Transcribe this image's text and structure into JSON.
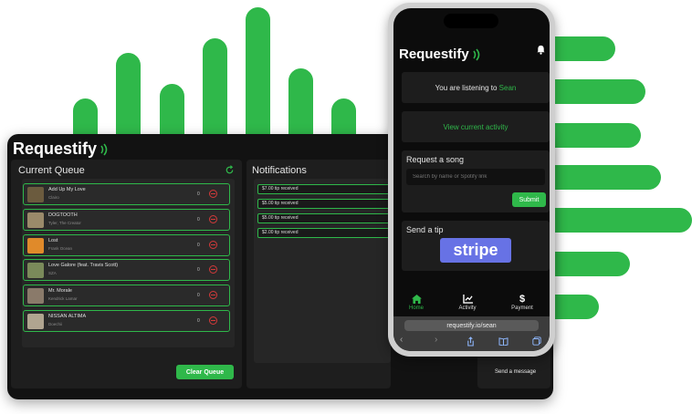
{
  "colors": {
    "accent": "#2fb84a",
    "danger": "#d43a3a",
    "background": "#121212"
  },
  "dashboard": {
    "brand": "Requestify",
    "queue_title": "Current Queue",
    "notifications_title": "Notifications",
    "clear_label": "Clear Queue",
    "send_message_label": "Send a message",
    "songs": [
      {
        "title": "Add Up My Love",
        "artist": "Clairo",
        "count": "0",
        "art": "#6b5b3e"
      },
      {
        "title": "DOGTOOTH",
        "artist": "Tyler, The Creator",
        "count": "0",
        "art": "#9a8a6a"
      },
      {
        "title": "Lost",
        "artist": "Frank Ocean",
        "count": "0",
        "art": "#e08a2a"
      },
      {
        "title": "Love Galore (feat. Travis Scott)",
        "artist": "SZA",
        "count": "0",
        "art": "#7a8a5a"
      },
      {
        "title": "Mr. Morale",
        "artist": "Kendrick Lamar",
        "count": "0",
        "art": "#8a7a6a"
      },
      {
        "title": "NISSAN ALTIMA",
        "artist": "Doechii",
        "count": "0",
        "art": "#b0a590"
      }
    ],
    "notifications": [
      "$7.00 tip received",
      "$5.00 tip received",
      "$5.00 tip received",
      "$2.00 tip received"
    ]
  },
  "phone": {
    "brand": "Requestify",
    "listening_prefix": "You are listening to",
    "dj_name": "Sean",
    "view_activity": "View current activity",
    "request_title": "Request a song",
    "search_placeholder": "Search by name or Spotify link",
    "submit_label": "Submit",
    "tip_title": "Send a tip",
    "stripe_label": "stripe",
    "nav": [
      {
        "label": "Home",
        "icon": "home-icon"
      },
      {
        "label": "Activity",
        "icon": "chart-icon"
      },
      {
        "label": "Payment",
        "icon": "dollar-icon"
      }
    ],
    "url": "requestify.io/sean"
  }
}
